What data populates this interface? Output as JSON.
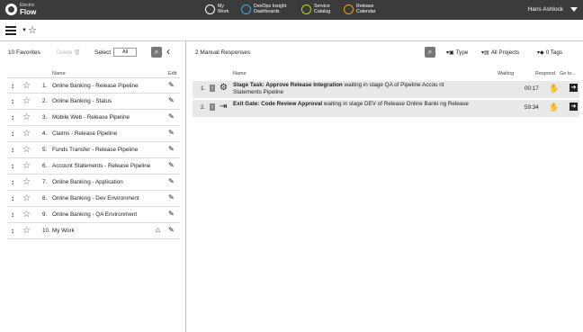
{
  "header": {
    "logo_small": "Electric",
    "logo_big": "Flow",
    "nav": [
      {
        "label": "My\nWork",
        "icon": "my-work-icon",
        "color": "#ffffff"
      },
      {
        "label": "DevOps Insight\nDashboards",
        "icon": "dashboard-icon",
        "color": "#4aa3df"
      },
      {
        "label": "Service\nCatalog",
        "icon": "service-catalog-icon",
        "color": "#c8d400"
      },
      {
        "label": "Release\nCalendar",
        "icon": "calendar-icon",
        "color": "#f39c12"
      }
    ],
    "user": "Hans Ashlock"
  },
  "favorites": {
    "count_label": "10 Favorites",
    "delete_label": "Delete",
    "select_label": "Select",
    "select_value": "All",
    "col_name": "Name",
    "col_edit": "Edit",
    "items": [
      {
        "num": "1.",
        "name": "Online Banking - Release Pipeline"
      },
      {
        "num": "2.",
        "name": "Online Banking - Status"
      },
      {
        "num": "3.",
        "name": "Mobile Web - Release Pipeline"
      },
      {
        "num": "4.",
        "name": "Claims - Release Pipeline"
      },
      {
        "num": "5.",
        "name": "Funds Transfer - Release Pipeline"
      },
      {
        "num": "6.",
        "name": "Account Statements - Release Pipeline"
      },
      {
        "num": "7.",
        "name": "Online Banking - Application"
      },
      {
        "num": "8.",
        "name": "Online Banking - Dev Environment"
      },
      {
        "num": "9.",
        "name": "Online Banking - QA Environment"
      },
      {
        "num": "10.",
        "name": "My Work"
      }
    ]
  },
  "responses": {
    "count_label": "2 Manual Responses",
    "filters": {
      "type": "Type",
      "projects": "All Projects",
      "tags": "0 Tags"
    },
    "cols": {
      "name": "Name",
      "waiting": "Waiting",
      "respond": "Respond",
      "goto": "Go to..."
    },
    "rows": [
      {
        "num": "1.",
        "icon": "gear-icon",
        "title": "Stage Task: Approve Release Integration",
        "desc": " waiting in stage QA of Pipeline Accou nt Statements Pipeline",
        "waiting": "00:17"
      },
      {
        "num": "2.",
        "icon": "exit-gate-icon",
        "title": "Exit Gate: Code Review Approval",
        "desc": " waiting in stage DEV of Release Online Banki ng Release",
        "waiting": "59:34"
      }
    ]
  }
}
